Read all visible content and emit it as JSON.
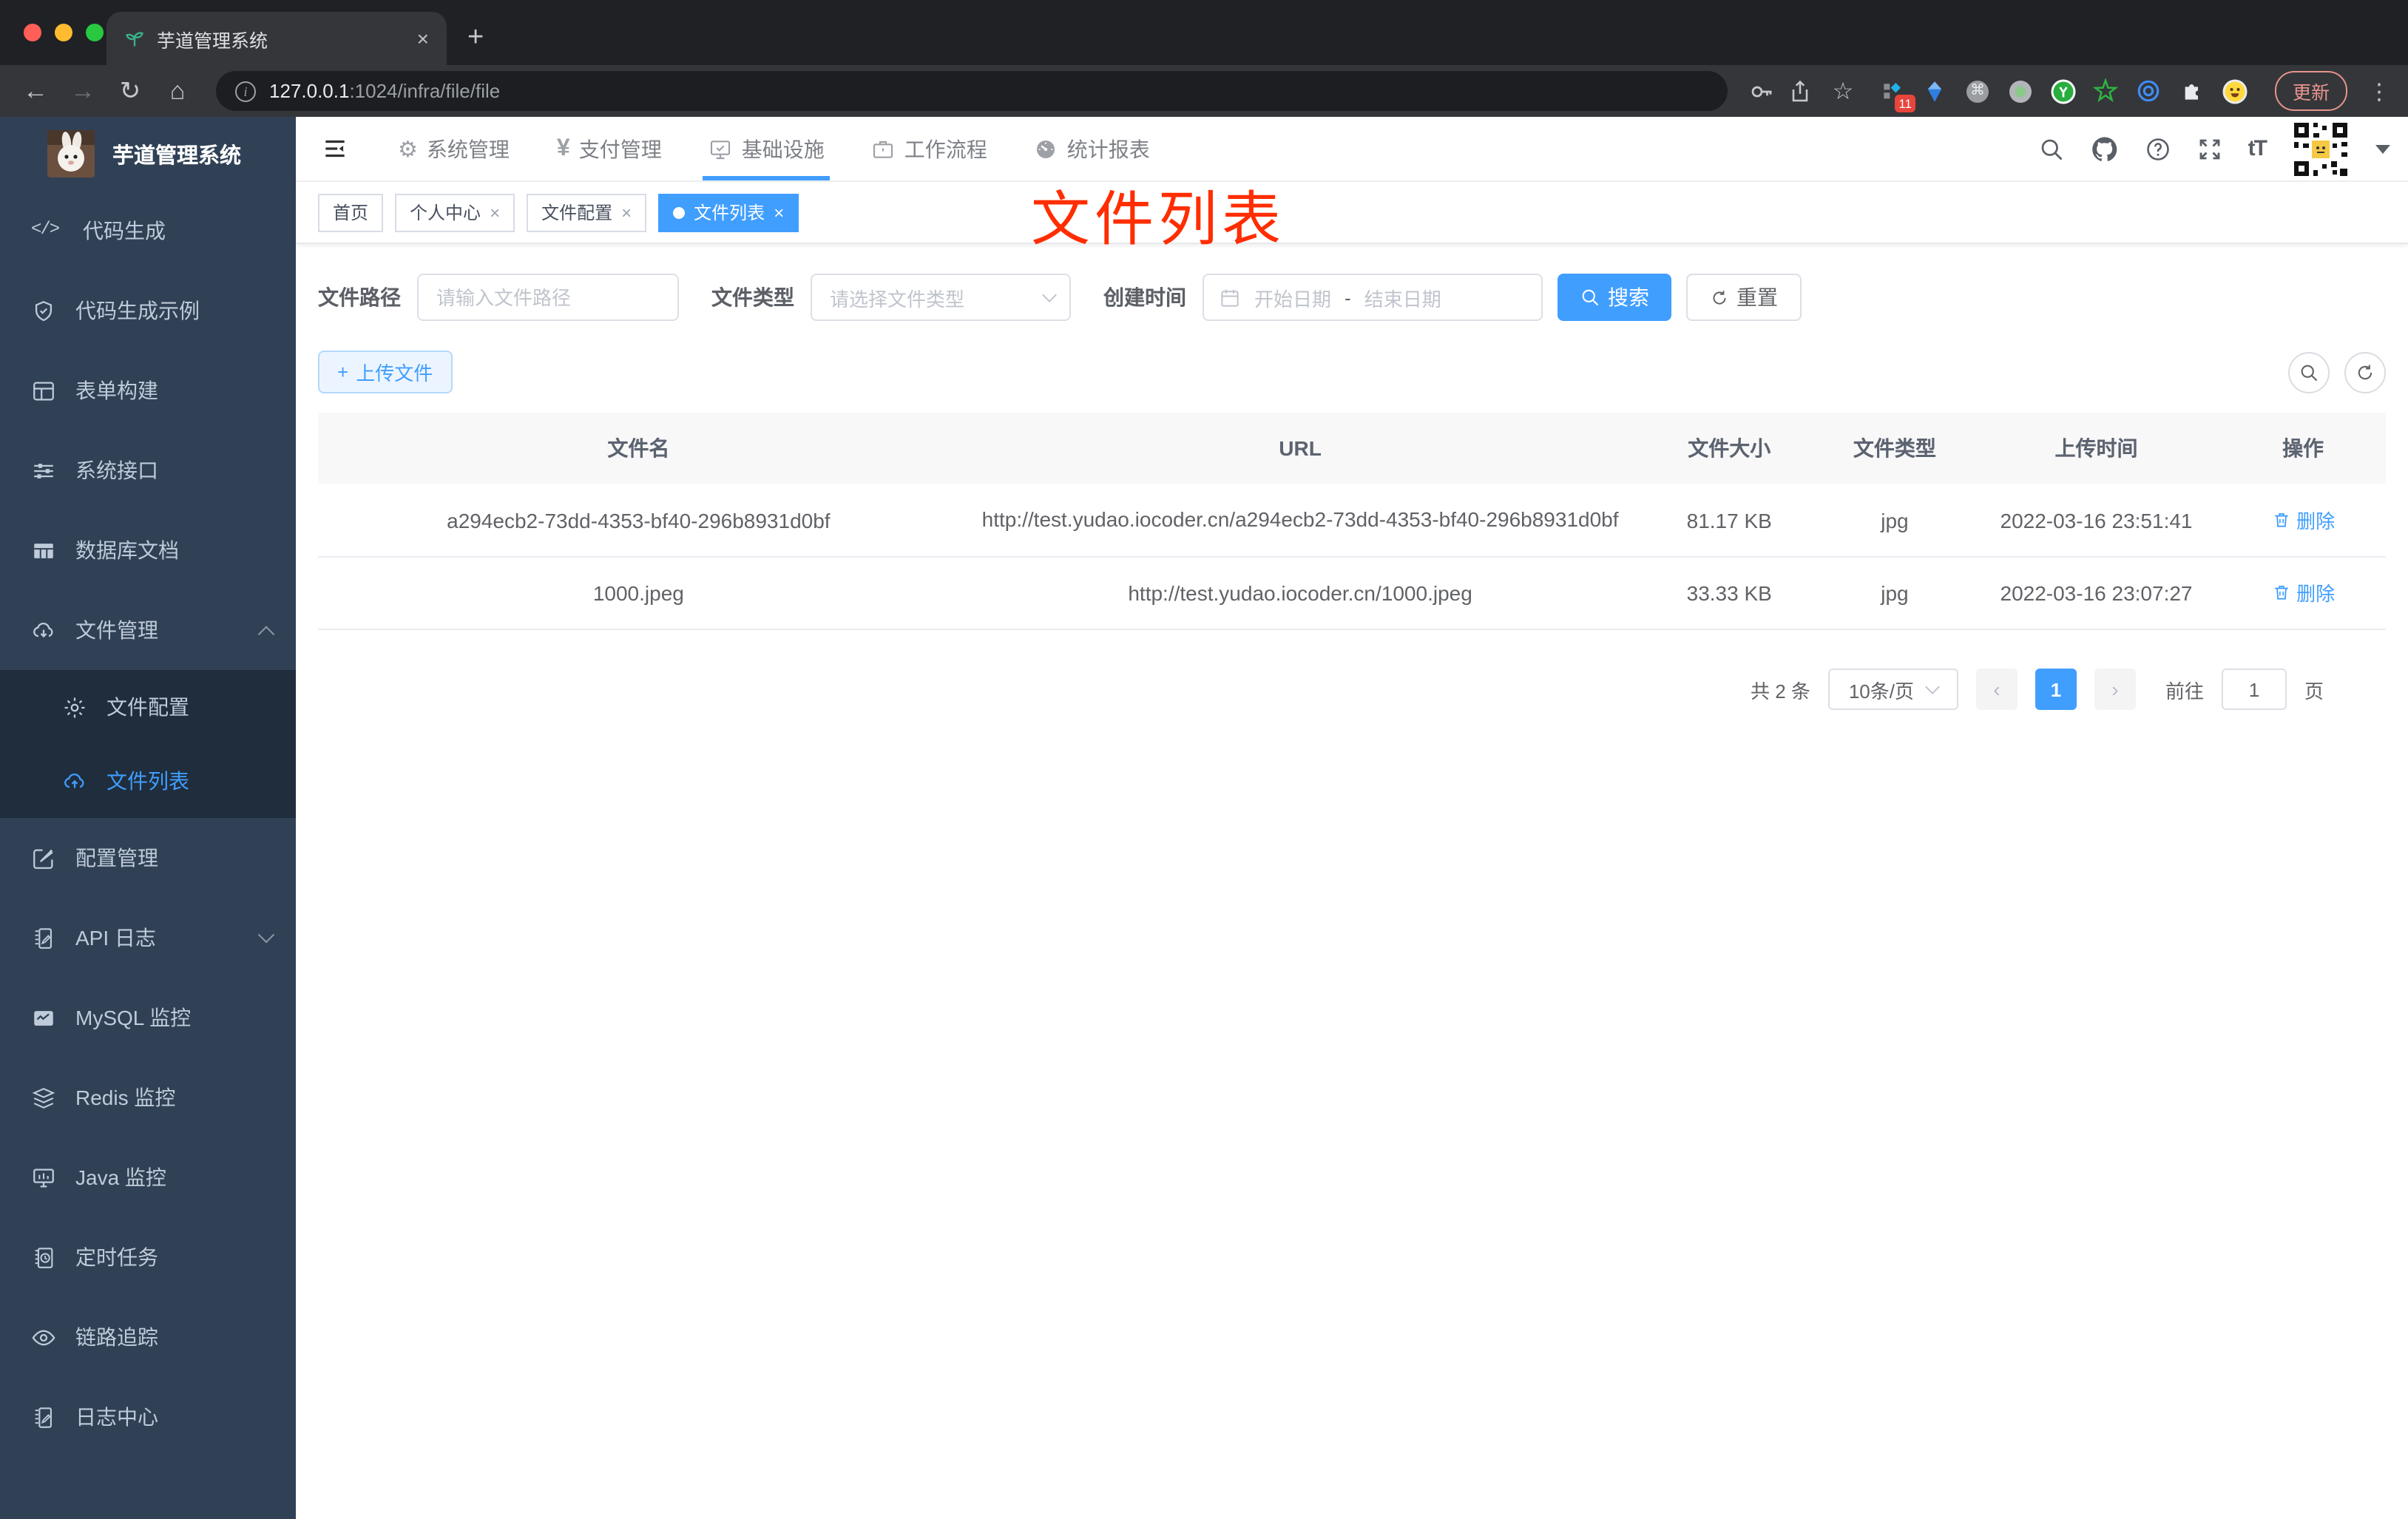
{
  "colors": {
    "accent": "#409eff",
    "sidebar_bg": "#304156",
    "submenu_bg": "#1f2d3d",
    "annotation_red": "#ff2d00"
  },
  "browser": {
    "tab_title": "芋道管理系统",
    "url_host": "127.0.0.1",
    "url_rest": ":1024/infra/file/file",
    "update_label": "更新",
    "extension_badge": "11"
  },
  "icons": {
    "close_glyph": "×",
    "plus_glyph": "+",
    "back_glyph": "←",
    "forward_glyph": "→",
    "reload_glyph": "↻",
    "home_glyph": "⌂",
    "star_glyph": "☆",
    "command_glyph": "⌘",
    "dots_glyph": "⋮",
    "gear_glyph": "⚙",
    "yen_glyph": "¥",
    "fontsize_glyph": "tT",
    "code_glyph": "</>",
    "info_glyph": "i",
    "prev_glyph": "‹",
    "next_glyph": "›"
  },
  "sidebar": {
    "logo_title": "芋道管理系统",
    "items": [
      {
        "label": "代码生成"
      },
      {
        "label": "代码生成示例"
      },
      {
        "label": "表单构建"
      },
      {
        "label": "系统接口"
      },
      {
        "label": "数据库文档"
      },
      {
        "label": "文件管理"
      },
      {
        "label": "文件配置"
      },
      {
        "label": "文件列表"
      },
      {
        "label": "配置管理"
      },
      {
        "label": "API 日志"
      },
      {
        "label": "MySQL 监控"
      },
      {
        "label": "Redis 监控"
      },
      {
        "label": "Java 监控"
      },
      {
        "label": "定时任务"
      },
      {
        "label": "链路追踪"
      },
      {
        "label": "日志中心"
      }
    ]
  },
  "navbar": {
    "menu": [
      {
        "label": "系统管理"
      },
      {
        "label": "支付管理"
      },
      {
        "label": "基础设施"
      },
      {
        "label": "工作流程"
      },
      {
        "label": "统计报表"
      }
    ]
  },
  "tags": [
    {
      "label": "首页"
    },
    {
      "label": "个人中心"
    },
    {
      "label": "文件配置"
    },
    {
      "label": "文件列表"
    }
  ],
  "annotation": "文件列表",
  "filters": {
    "path_label": "文件路径",
    "path_placeholder": "请输入文件路径",
    "type_label": "文件类型",
    "type_placeholder": "请选择文件类型",
    "date_label": "创建时间",
    "date_start": "开始日期",
    "date_separator": "-",
    "date_end": "结束日期",
    "search_label": "搜索",
    "reset_label": "重置"
  },
  "toolbar": {
    "upload_label": "上传文件"
  },
  "table": {
    "headers": [
      "文件名",
      "URL",
      "文件大小",
      "文件类型",
      "上传时间",
      "操作"
    ],
    "rows": [
      {
        "name": "a294ecb2-73dd-4353-bf40-296b8931d0bf",
        "url": "http://test.yudao.iocoder.cn/a294ecb2-73dd-4353-bf40-296b8931d0bf",
        "size": "81.17 KB",
        "type": "jpg",
        "time": "2022-03-16 23:51:41",
        "action": "删除"
      },
      {
        "name": "1000.jpeg",
        "url": "http://test.yudao.iocoder.cn/1000.jpeg",
        "size": "33.33 KB",
        "type": "jpg",
        "time": "2022-03-16 23:07:27",
        "action": "删除"
      }
    ]
  },
  "pagination": {
    "total": "共 2 条",
    "page_size": "10条/页",
    "current": "1",
    "goto_label": "前往",
    "goto_value": "1",
    "page_suffix": "页"
  }
}
